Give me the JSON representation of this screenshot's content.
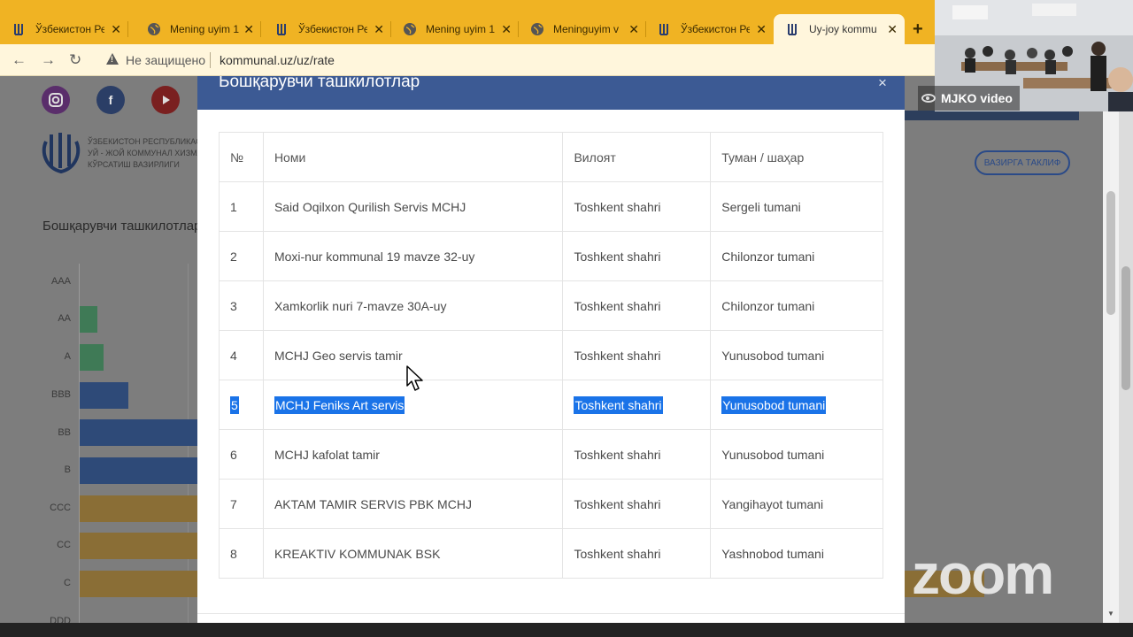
{
  "browser": {
    "tabs": [
      {
        "title": "Ўзбекистон Ре",
        "icon": "site-logo-icon"
      },
      {
        "title": "Mening uyim 1",
        "icon": "globe-icon"
      },
      {
        "title": "Ўзбекистон Ре",
        "icon": "site-logo-icon"
      },
      {
        "title": "Mening uyim 1",
        "icon": "globe-icon"
      },
      {
        "title": "Meninguyim v",
        "icon": "globe-icon"
      },
      {
        "title": "Ўзбекистон Ре",
        "icon": "site-logo-icon"
      },
      {
        "title": "Uy-joy kommu",
        "icon": "site-logo-icon",
        "active": true
      }
    ],
    "new_tab": "+",
    "address": {
      "security_label": "Не защищено",
      "url": "kommunal.uz/uz/rate"
    }
  },
  "page": {
    "org_lines": [
      "ЎЗБЕКИСТОН РЕСПУБЛИКАСИ",
      "УЙ - ЖОЙ КОММУНАЛ ХИЗМАТ",
      "КЎРСАТИШ ВАЗИРЛИГИ"
    ],
    "title": "Бошқарувчи ташкилотлар",
    "proposal_button": "ВАЗИРГА ТАКЛИФ",
    "rating_labels": [
      "AAA",
      "AA",
      "A",
      "BBB",
      "BB",
      "B",
      "CCC",
      "CC",
      "C",
      "DDD"
    ]
  },
  "modal": {
    "title": "Бошқарувчи ташкилотлар",
    "close": "×",
    "columns": [
      "№",
      "Номи",
      "Вилоят",
      "Туман / шаҳар"
    ],
    "rows": [
      [
        "1",
        "Said Oqilxon Qurilish Servis MCHJ",
        "Toshkent shahri",
        "Sergeli tumani"
      ],
      [
        "2",
        "Moxi-nur kommunal 19 mavze 32-uy",
        "Toshkent shahri",
        "Chilonzor tumani"
      ],
      [
        "3",
        "Xamkorlik nuri 7-mavze 30A-uy",
        "Toshkent shahri",
        "Chilonzor tumani"
      ],
      [
        "4",
        "MCHJ Geo servis tamir",
        "Toshkent shahri",
        "Yunusobod tumani"
      ],
      [
        "5",
        "MCHJ Feniks Art servis",
        "Toshkent shahri",
        "Yunusobod tumani"
      ],
      [
        "6",
        "MCHJ kafolat tamir",
        "Toshkent shahri",
        "Yunusobod tumani"
      ],
      [
        "7",
        "AKTAM TAMIR SERVIS PBK MCHJ",
        "Toshkent shahri",
        "Yangihayot tumani"
      ],
      [
        "8",
        "KREAKTIV KOMMUNAK BSK",
        "Toshkent shahri",
        "Yashnobod tumani"
      ]
    ],
    "selected_row": 4
  },
  "video": {
    "label": "MJKO video"
  },
  "watermark": "zoom"
}
